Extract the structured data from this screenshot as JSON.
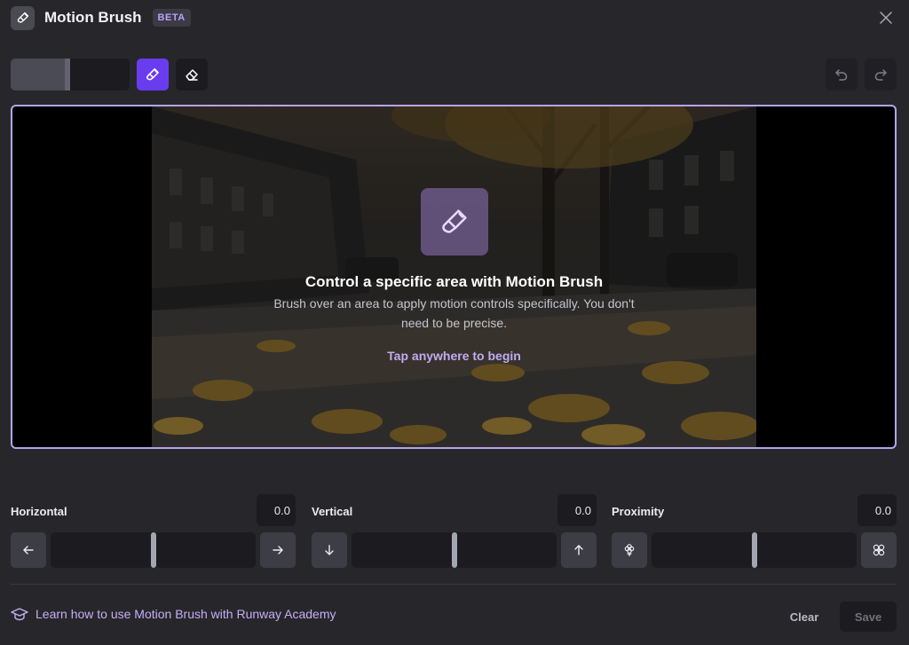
{
  "header": {
    "title": "Motion Brush",
    "badge": "BETA",
    "app_icon": "brush-icon",
    "close_icon": "close-icon"
  },
  "toolbar": {
    "brush_size_fraction": 0.5,
    "tools": [
      "brush-icon",
      "eraser-icon",
      "undo-icon",
      "redo-icon"
    ],
    "active_tool": "brush",
    "accent_color": "#6a3cf0"
  },
  "canvas": {
    "title": "Control a specific area with Motion Brush",
    "description": "Brush over an area to apply motion controls specifically. You don't need to be precise.",
    "cta": "Tap anywhere to begin",
    "border_color": "#b7a3e8"
  },
  "controls": {
    "horizontal": {
      "label": "Horizontal",
      "value": "0.0",
      "position": 0.5,
      "left_icon": "arrow-left-icon",
      "right_icon": "arrow-right-icon"
    },
    "vertical": {
      "label": "Vertical",
      "value": "0.0",
      "position": 0.5,
      "left_icon": "arrow-down-icon",
      "right_icon": "arrow-up-icon"
    },
    "proximity": {
      "label": "Proximity",
      "value": "0.0",
      "position": 0.5,
      "left_icon": "flower-icon",
      "right_icon": "flower-spread-icon"
    }
  },
  "footer": {
    "learn_text": "Learn how to use Motion Brush with Runway Academy",
    "learn_icon": "graduation-cap-icon",
    "clear_label": "Clear",
    "save_label": "Save"
  }
}
